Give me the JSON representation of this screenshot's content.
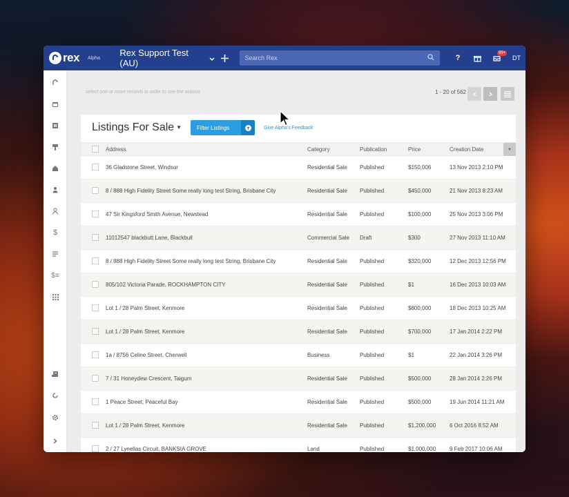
{
  "topbar": {
    "logo_text": "rex",
    "logo_badge": "Alpha",
    "account_name": "Rex Support Test (AU)",
    "search_placeholder": "Search Rex",
    "notification_count": "99+",
    "user_initials": "DT"
  },
  "sidebar": {
    "items": [
      "home-icon",
      "calendar-icon",
      "contacts-book-icon",
      "signboard-icon",
      "listings-house-icon",
      "person-icon",
      "people-icon",
      "dollar-icon",
      "list-icon",
      "finance-icon",
      "apps-grid-icon"
    ],
    "bottom_items": [
      "report-icon",
      "refresh-icon",
      "settings-gear-icon",
      "expand-chevron-icon"
    ]
  },
  "toolbar": {
    "actions_hint": "select one or more records in order to see the actions",
    "pager_text": "1 - 20 of 562"
  },
  "panel": {
    "title": "Listings For Sale",
    "filter_button": "Filter Listings",
    "feedback_link": "Give Alpha's Feedback"
  },
  "table": {
    "columns": [
      "Address",
      "Category",
      "Publication",
      "Price",
      "Creation Date"
    ],
    "rows": [
      {
        "address": "36 Gladstone Street, Windsor",
        "category": "Residential Sale",
        "publication": "Published",
        "price": "$150,006",
        "date": "13 Nov 2013 2:10 PM"
      },
      {
        "address": "8 / 888 High Fidelity Street Some really long test String, Brisbane City",
        "category": "Residential Sale",
        "publication": "Published",
        "price": "$450,000",
        "date": "21 Nov 2013 8:23 AM"
      },
      {
        "address": "47 Sir Kingsford Smith Avenue, Newstead",
        "category": "Residential Sale",
        "publication": "Published",
        "price": "$100,000",
        "date": "25 Nov 2013 3:06 PM"
      },
      {
        "address": "11012547 blackbutt Lane, Blackbull",
        "category": "Commercial Sale",
        "publication": "Draft",
        "price": "$300",
        "date": "27 Nov 2013 11:10 AM"
      },
      {
        "address": "8 / 888 High Fidelity Street Some really long test String, Brisbane City",
        "category": "Residential Sale",
        "publication": "Published",
        "price": "$320,000",
        "date": "12 Dec 2013 12:56 PM"
      },
      {
        "address": "805/102 Victoria Parade, ROCKHAMPTON CITY",
        "category": "Residential Sale",
        "publication": "Published",
        "price": "$1",
        "date": "16 Dec 2013 10:03 AM"
      },
      {
        "address": "Lot 1 / 28 Palm Street, Kenmore",
        "category": "Residential Sale",
        "publication": "Published",
        "price": "$800,000",
        "date": "18 Dec 2013 10:25 AM"
      },
      {
        "address": "Lot 1 / 28 Palm Street, Kenmore",
        "category": "Residential Sale",
        "publication": "Published",
        "price": "$700,000",
        "date": "17 Jan 2014 2:22 PM"
      },
      {
        "address": "1a / 8756 Celine Street, Cherwell",
        "category": "Business",
        "publication": "Published",
        "price": "$1",
        "date": "22 Jan 2014 3:26 PM"
      },
      {
        "address": "7 / 31 Honeydew Crescent, Taigum",
        "category": "Residential Sale",
        "publication": "Published",
        "price": "$500,000",
        "date": "28 Jan 2014 2:26 PM"
      },
      {
        "address": "1 Peace Street, Peaceful Bay",
        "category": "Residential Sale",
        "publication": "Published",
        "price": "$500,000",
        "date": "19 Jun 2014 11:21 AM"
      },
      {
        "address": "Lot 1 / 28 Palm Street, Kenmore",
        "category": "Residential Sale",
        "publication": "Published",
        "price": "$1,200,000",
        "date": "6 Oct 2016 8:52 AM"
      },
      {
        "address": "2 / 27 Lynellas Circuit, BANKSIA GROVE",
        "category": "Land",
        "publication": "Published",
        "price": "$1,000,000",
        "date": "9 Feb 2017 10:06 AM"
      }
    ]
  },
  "colors": {
    "topbar": "#23408f",
    "search": "#4a67b1",
    "accent": "#2a9de3",
    "notification": "#e23b3b"
  }
}
